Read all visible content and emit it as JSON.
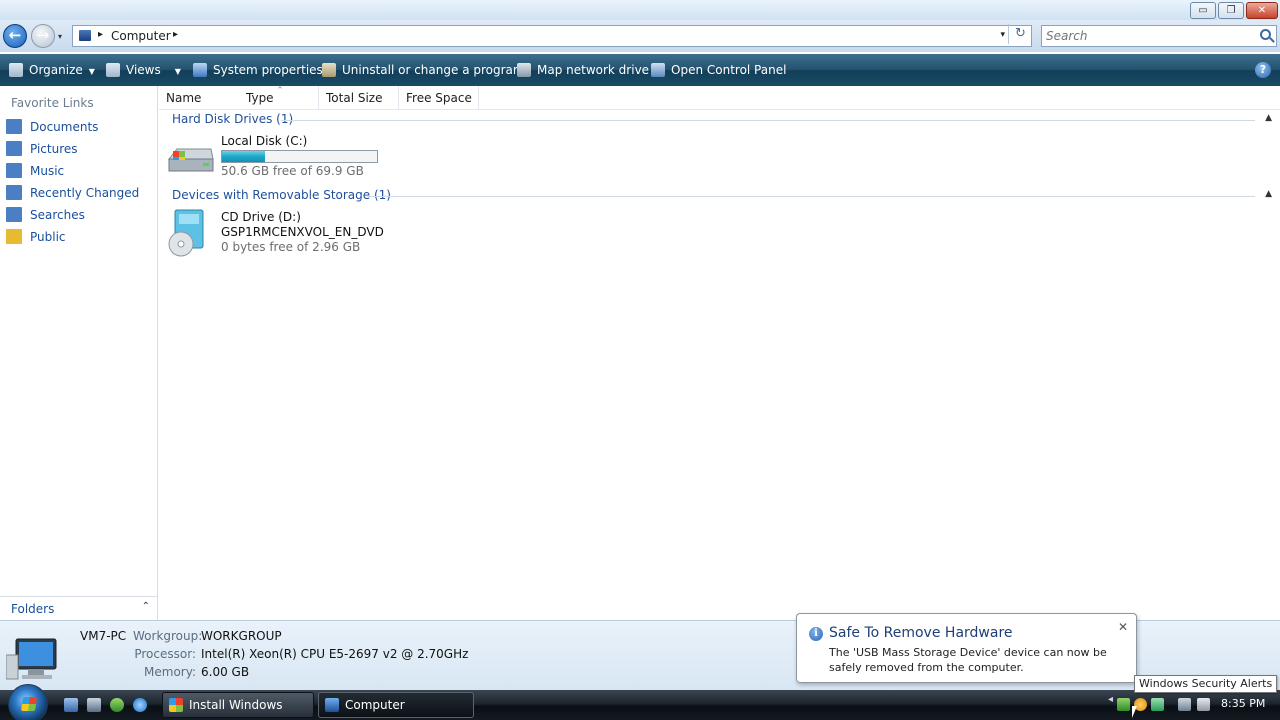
{
  "window": {
    "minimize": "▭",
    "maximize": "❐",
    "close": "✕"
  },
  "address_bar": {
    "location": "Computer",
    "separator": "▸",
    "dropdown": "▾",
    "refresh": "↻"
  },
  "search": {
    "placeholder": "Search"
  },
  "command_bar": {
    "organize": "Organize",
    "views": "Views",
    "system_properties": "System properties",
    "uninstall": "Uninstall or change a program",
    "map_network_drive": "Map network drive",
    "open_control_panel": "Open Control Panel",
    "help": "?"
  },
  "sidebar": {
    "title": "Favorite Links",
    "items": [
      {
        "label": "Documents",
        "color": "#4a7fc3"
      },
      {
        "label": "Pictures",
        "color": "#4a7fc3"
      },
      {
        "label": "Music",
        "color": "#4a7fc3"
      },
      {
        "label": "Recently Changed",
        "color": "#4a7fc3"
      },
      {
        "label": "Searches",
        "color": "#4a7fc3"
      },
      {
        "label": "Public",
        "color": "#e8b931"
      }
    ],
    "folders_label": "Folders",
    "folders_caret": "⌃"
  },
  "columns": [
    "Name",
    "Type",
    "Total Size",
    "Free Space"
  ],
  "groups": {
    "hard_disks": "Hard Disk Drives (1)",
    "removable": "Devices with Removable Storage (1)"
  },
  "drives": {
    "c": {
      "name": "Local Disk (C:)",
      "free_text": "50.6 GB free of 69.9 GB",
      "used_fraction": 0.276
    },
    "d": {
      "name": "CD Drive (D:)",
      "label": "GSP1RMCENXVOL_EN_DVD",
      "free_text": "0 bytes free of 2.96 GB"
    }
  },
  "details": {
    "computer_name": "VM7-PC",
    "workgroup_label": "Workgroup:",
    "workgroup": "WORKGROUP",
    "processor_label": "Processor:",
    "processor": "Intel(R) Xeon(R) CPU E5-2697 v2 @ 2.70GHz",
    "memory_label": "Memory:",
    "memory": "6.00 GB"
  },
  "balloon": {
    "title": "Safe To Remove Hardware",
    "text": "The 'USB Mass Storage Device' device can now be safely removed from the computer.",
    "close": "✕",
    "info": "i"
  },
  "tooltip": "Windows Security Alerts",
  "taskbar": {
    "tasks": [
      "Install Windows",
      "Computer"
    ],
    "clock": "8:35 PM"
  }
}
